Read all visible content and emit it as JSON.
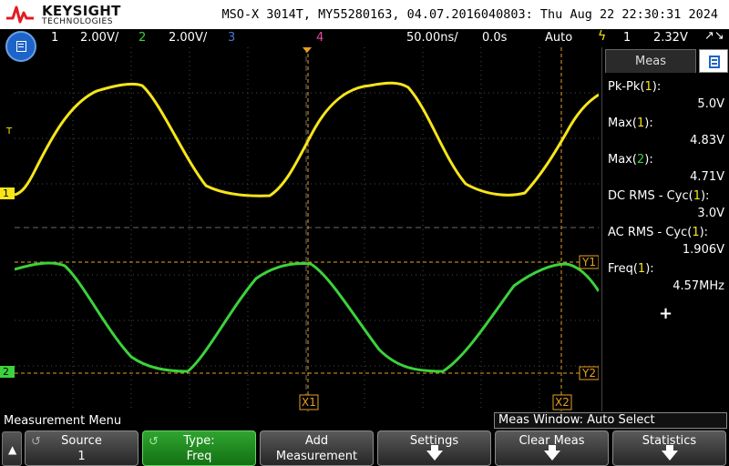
{
  "header": {
    "brand": "KEYSIGHT",
    "brand_sub": "TECHNOLOGIES",
    "scope_info": "MSO-X 3014T, MY55280163, 04.07.2016040803: Thu Aug 22 22:30:31 2024"
  },
  "channel_bar": {
    "ch1_num": "1",
    "ch1_scale": "2.00V/",
    "ch2_num": "2",
    "ch2_scale": "2.00V/",
    "ch3_num": "3",
    "ch4_num": "4",
    "timebase": "50.00ns/",
    "delay": "0.0s",
    "trigger_mode": "Auto",
    "trigger_source": "1",
    "trigger_level": "2.32V",
    "trigger_slope_symbol": "↗↘"
  },
  "icons": {
    "menu": "menu-icon",
    "trigger": "trigger-icon",
    "back": "back-arrow-icon",
    "knob": "knob-icon",
    "down": "down-arrow-icon",
    "add": "plus-icon"
  },
  "colors": {
    "ch1": "#f7e51a",
    "ch2": "#3cd23c",
    "ch3": "#4e76e0",
    "ch4": "#e64aa0",
    "cursor": "#e8a020",
    "menu_accent": "#1e64c8"
  },
  "graticule": {
    "trigger_marker": "T",
    "ch1_marker": "1",
    "ch2_marker": "2",
    "cursor_x1": "X1",
    "cursor_x2": "X2",
    "cursor_y1": "Y1",
    "cursor_y2": "Y2"
  },
  "measurements": {
    "tab_label": "Meas",
    "items": [
      {
        "label": "Pk-Pk",
        "ch": "1",
        "value": "5.0V"
      },
      {
        "label": "Max",
        "ch": "1",
        "value": "4.83V"
      },
      {
        "label": "Max",
        "ch": "2",
        "value": "4.71V"
      },
      {
        "label": "DC RMS - Cyc",
        "ch": "1",
        "value": "3.0V"
      },
      {
        "label": "AC RMS - Cyc",
        "ch": "1",
        "value": "1.906V"
      },
      {
        "label": "Freq",
        "ch": "1",
        "value": "4.57MHz"
      }
    ],
    "add": "+"
  },
  "menu": {
    "title": "Measurement Menu",
    "meas_window": "Meas Window: Auto Select",
    "softkeys": [
      {
        "line1": "Source",
        "line2": "1"
      },
      {
        "line1": "Type:",
        "line2": "Freq"
      },
      {
        "line1": "Add",
        "line2": "Measurement"
      },
      {
        "line1": "Settings",
        "line2": ""
      },
      {
        "line1": "Clear Meas",
        "line2": ""
      },
      {
        "line1": "Statistics",
        "line2": ""
      }
    ]
  }
}
